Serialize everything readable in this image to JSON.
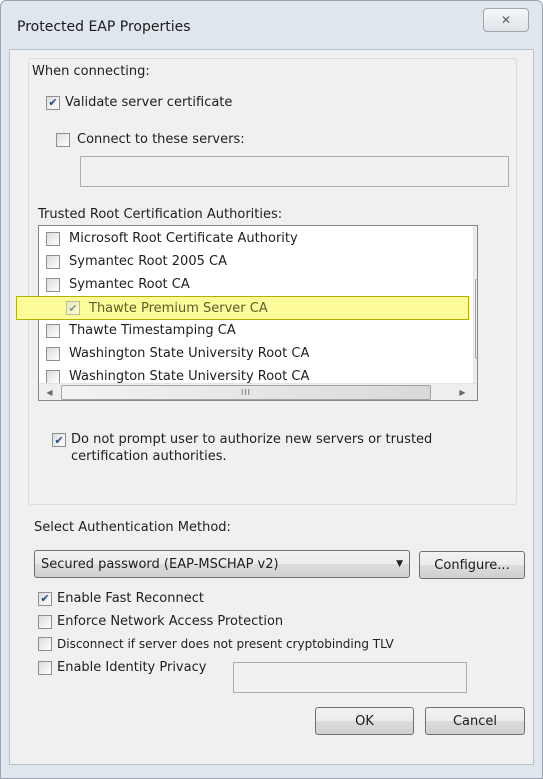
{
  "window": {
    "title": "Protected EAP Properties",
    "close_glyph": "✕"
  },
  "connecting": {
    "heading": "When connecting:",
    "validate_label": "Validate server certificate",
    "validate_checked": true,
    "connect_label": "Connect to these servers:",
    "connect_checked": false,
    "servers_value": "",
    "trusted_heading": "Trusted Root Certification Authorities:",
    "ca_items": [
      {
        "label": "Microsoft Root Certificate Authority",
        "checked": false
      },
      {
        "label": "Symantec Root 2005 CA",
        "checked": false
      },
      {
        "label": "Symantec Root CA",
        "checked": false
      },
      {
        "label": "Thawte Premium Server CA",
        "checked": true
      },
      {
        "label": "Thawte Timestamping CA",
        "checked": false
      },
      {
        "label": "Washington State University Root CA",
        "checked": false
      },
      {
        "label": "Washington State University Root CA",
        "checked": false
      }
    ],
    "hscroll_thumb_glyph": "III",
    "vscroll_thumb_glyph": "≡",
    "noprompt_label_line1": "Do not prompt user to authorize new servers or trusted",
    "noprompt_label_line2": "certification authorities.",
    "noprompt_checked": true
  },
  "auth": {
    "heading": "Select Authentication Method:",
    "method_value": "Secured password (EAP-MSCHAP v2)",
    "configure_label": "Configure...",
    "options": [
      {
        "label": "Enable Fast Reconnect",
        "checked": true
      },
      {
        "label": "Enforce Network Access Protection",
        "checked": false
      },
      {
        "label": "Disconnect if server does not present cryptobinding TLV",
        "checked": false
      },
      {
        "label": "Enable Identity Privacy",
        "checked": false
      }
    ],
    "identity_value": ""
  },
  "footer": {
    "ok_label": "OK",
    "cancel_label": "Cancel"
  },
  "colors": {
    "highlight": "#fbfb9a",
    "check": "#2a4a8a"
  }
}
